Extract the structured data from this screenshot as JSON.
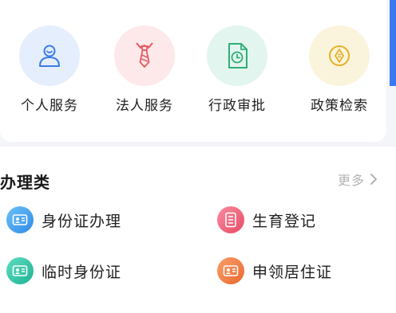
{
  "services": [
    {
      "label": "个人服务",
      "icon": "person-icon",
      "bg": "#e5eefc",
      "color": "#3a7bea"
    },
    {
      "label": "法人服务",
      "icon": "tie-icon",
      "bg": "#fde8ea",
      "color": "#e8575f"
    },
    {
      "label": "行政审批",
      "icon": "document-clock-icon",
      "bg": "#e2f5ee",
      "color": "#2fae78"
    },
    {
      "label": "政策检索",
      "icon": "coin-icon",
      "bg": "#fbf4dc",
      "color": "#e5b22a"
    }
  ],
  "section": {
    "title": "办理类",
    "more_label": "更多"
  },
  "items": [
    {
      "label": "身份证办理",
      "icon": "id-card-icon",
      "color": "#3ea0f0"
    },
    {
      "label": "生育登记",
      "icon": "form-icon",
      "color": "#f0617a"
    },
    {
      "label": "临时身份证",
      "icon": "id-card-icon",
      "color": "#2fbfa0"
    },
    {
      "label": "申领居住证",
      "icon": "residence-card-icon",
      "color": "#f08040"
    }
  ]
}
